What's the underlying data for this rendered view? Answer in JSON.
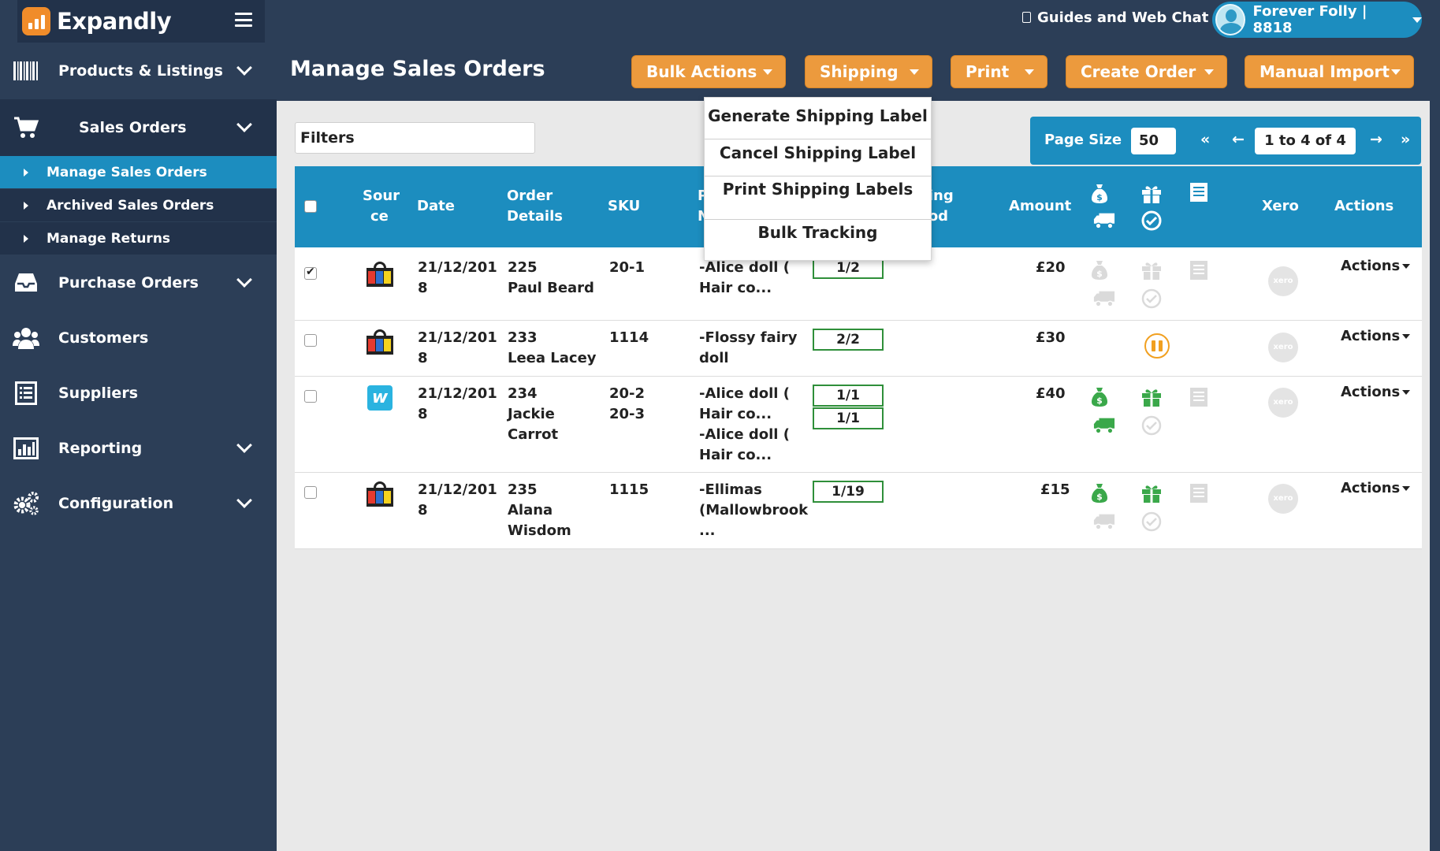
{
  "app": {
    "name": "Expandly"
  },
  "topbar": {
    "guides_label": "Guides and Web Chat",
    "user_label": "Forever Folly | 8818"
  },
  "sidebar": {
    "items": [
      {
        "label": "Products & Listings",
        "icon": "barcode-icon"
      },
      {
        "label": "Sales Orders",
        "icon": "cart-icon"
      },
      {
        "label": "Purchase Orders",
        "icon": "inbox-icon"
      },
      {
        "label": "Customers",
        "icon": "users-icon"
      },
      {
        "label": "Suppliers",
        "icon": "list-icon"
      },
      {
        "label": "Reporting",
        "icon": "bar-chart-icon"
      },
      {
        "label": "Configuration",
        "icon": "gears-icon"
      }
    ],
    "sub_items": [
      {
        "label": "Manage Sales Orders",
        "active": true
      },
      {
        "label": "Archived Sales Orders"
      },
      {
        "label": "Manage Returns"
      }
    ]
  },
  "header": {
    "title": "Manage Sales Orders",
    "buttons": [
      "Bulk Actions",
      "Shipping",
      "Print",
      "Create Order",
      "Manual Import"
    ]
  },
  "filters": {
    "placeholder": "Filters"
  },
  "pager": {
    "page_size_label": "Page Size",
    "page_size": "50",
    "first": "«",
    "prev": "←",
    "range": "1 to 4 of 4",
    "next": "→",
    "last": "»"
  },
  "shipping_menu": {
    "items": [
      "Generate Shipping Label",
      "Cancel Shipping Label",
      "Print Shipping Labels",
      "Bulk Tracking"
    ]
  },
  "table": {
    "headers": {
      "source_1": "Sour",
      "source_2": "ce",
      "date": "Date",
      "order_1": "Order",
      "order_2": "Details",
      "sku": "SKU",
      "product_1": "P",
      "product_2": "N",
      "shipping_1": "ping",
      "shipping_2": "hod",
      "amount": "Amount",
      "xero": "Xero",
      "actions": "Actions"
    },
    "rows": [
      {
        "checked": true,
        "source": "shopping-bag",
        "date_1": "21/12/201",
        "date_2": "8",
        "order_no": "225",
        "customer_1": "Paul Beard",
        "customer_2": "",
        "sku_1": "20-1",
        "sku_2": "",
        "prod_1": "-Alice doll (",
        "prod_2": "Hair co...",
        "prod_3": "",
        "prod_4": "",
        "qty_1": "1/2",
        "qty_2": "",
        "amount": "£20",
        "actions": "Actions",
        "xero": "xero"
      },
      {
        "checked": false,
        "source": "shopping-bag",
        "date_1": "21/12/201",
        "date_2": "8",
        "order_no": "233",
        "customer_1": "Leea Lacey",
        "customer_2": "",
        "sku_1": "1114",
        "sku_2": "",
        "prod_1": "-Flossy fairy",
        "prod_2": "doll",
        "prod_3": "",
        "prod_4": "",
        "qty_1": "2/2",
        "qty_2": "",
        "amount": "£30",
        "actions": "Actions",
        "xero": "xero"
      },
      {
        "checked": false,
        "source": "wish",
        "date_1": "21/12/201",
        "date_2": "8",
        "order_no": "234",
        "customer_1": "Jackie",
        "customer_2": "Carrot",
        "sku_1": "20-2",
        "sku_2": "20-3",
        "prod_1": "-Alice doll (",
        "prod_2": "Hair co...",
        "prod_3": "-Alice doll (",
        "prod_4": "Hair co...",
        "qty_1": "1/1",
        "qty_2": "1/1",
        "amount": "£40",
        "actions": "Actions",
        "xero": "xero"
      },
      {
        "checked": false,
        "source": "shopping-bag",
        "date_1": "21/12/201",
        "date_2": "8",
        "order_no": "235",
        "customer_1": "Alana",
        "customer_2": "Wisdom",
        "sku_1": "1115",
        "sku_2": "",
        "prod_1": "-Ellimas",
        "prod_2": "(Mallowbrook",
        "prod_3": "...",
        "prod_4": "",
        "qty_1": "1/19",
        "qty_2": "",
        "amount": "£15",
        "actions": "Actions",
        "xero": "xero"
      }
    ],
    "wish_letter": "w"
  },
  "colors": {
    "navy": "#2c3e57",
    "blue": "#1c8dbf",
    "orange": "#ec9a3d",
    "green": "#2f8f3a",
    "faded": "#d9d9d9"
  }
}
